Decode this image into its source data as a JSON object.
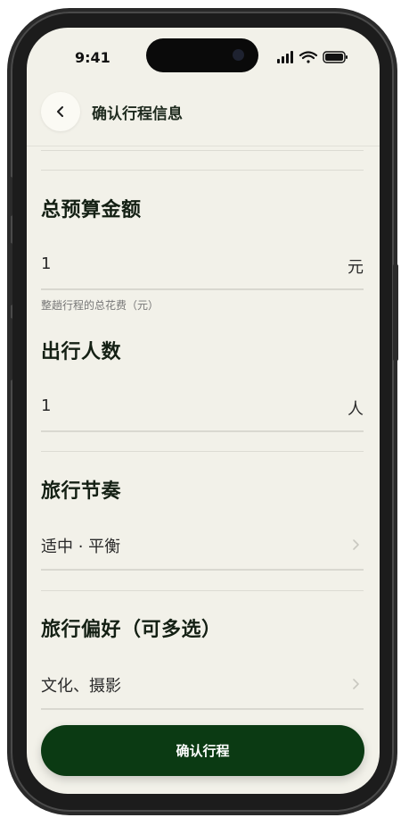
{
  "status_bar": {
    "time": "9:41"
  },
  "header": {
    "title": "确认行程信息"
  },
  "budget": {
    "title": "总预算金额",
    "value": "1",
    "unit": "元",
    "hint": "整趟行程的总花费（元）"
  },
  "travelers": {
    "title": "出行人数",
    "value": "1",
    "unit": "人"
  },
  "pace": {
    "title": "旅行节奏",
    "value": "适中 · 平衡"
  },
  "preferences": {
    "title": "旅行偏好（可多选）",
    "value": "文化、摄影"
  },
  "footer": {
    "confirm_label": "确认行程"
  },
  "colors": {
    "background": "#f2f1e9",
    "primary": "#0b3a13",
    "text": "#142014"
  }
}
